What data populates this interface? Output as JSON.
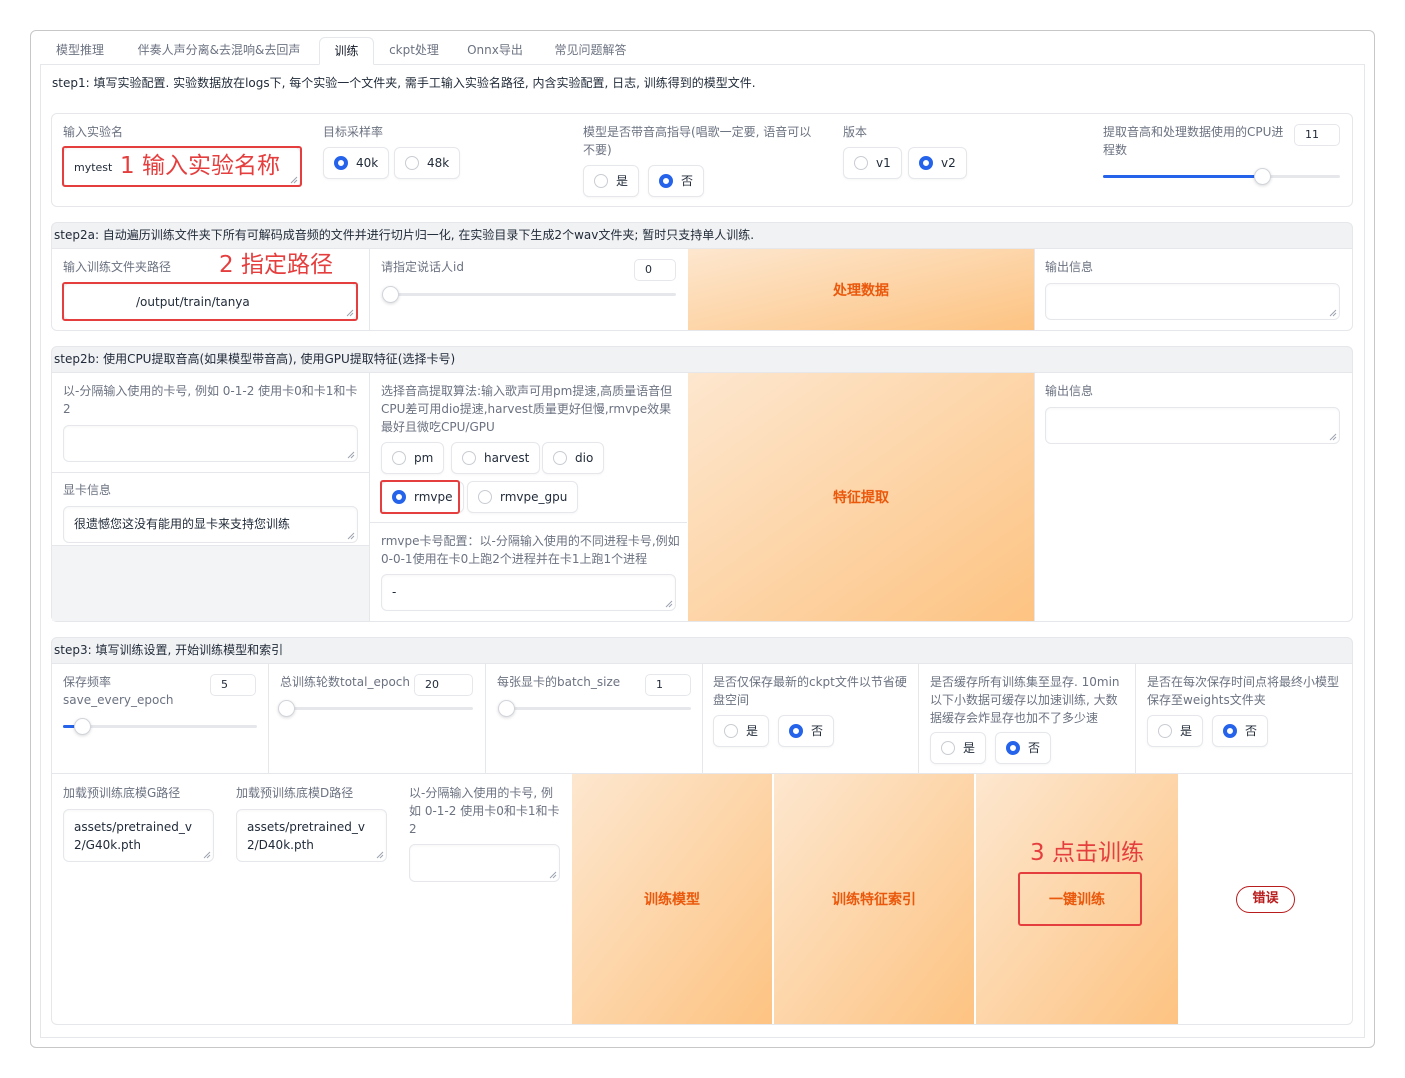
{
  "tabs": [
    "模型推理",
    "伴奏人声分离&去混响&去回声",
    "训练",
    "ckpt处理",
    "Onnx导出",
    "常见问题解答"
  ],
  "step1": {
    "desc": "step1: 填写实验配置. 实验数据放在logs下, 每个实验一个文件夹, 需手工输入实验名路径, 内含实验配置, 日志, 训练得到的模型文件.",
    "exp_name_label": "输入实验名",
    "exp_name_value": "mytest",
    "annotation": "1 输入实验名称",
    "sr_label": "目标采样率",
    "sr_options": [
      "40k",
      "48k"
    ],
    "pitch_label": "模型是否带音高指导(唱歌一定要, 语音可以不要)",
    "pitch_options": [
      "是",
      "否"
    ],
    "version_label": "版本",
    "version_options": [
      "v1",
      "v2"
    ],
    "cpu_label": "提取音高和处理数据使用的CPU进程数",
    "cpu_value": "11",
    "cpu_fraction": 0.67
  },
  "step2a": {
    "desc": "step2a: 自动遍历训练文件夹下所有可解码成音频的文件并进行切片归一化, 在实验目录下生成2个wav文件夹; 暂时只支持单人训练.",
    "folder_label": "输入训练文件夹路径",
    "folder_value": "/output/train/tanya",
    "annotation": "2 指定路径",
    "speaker_label": "请指定说话人id",
    "speaker_value": "0",
    "process_button": "处理数据",
    "output_label": "输出信息"
  },
  "step2b": {
    "desc": "step2b: 使用CPU提取音高(如果模型带音高), 使用GPU提取特征(选择卡号)",
    "gpus_label": "以-分隔输入使用的卡号, 例如 0-1-2 使用卡0和卡1和卡2",
    "gpu_info_label": "显卡信息",
    "gpu_info_value": "很遗憾您这没有能用的显卡来支持您训练",
    "f0_label": "选择音高提取算法:输入歌声可用pm提速,高质量语音但CPU差可用dio提速,harvest质量更好但慢,rmvpe效果最好且微吃CPU/GPU",
    "f0_options": [
      "pm",
      "harvest",
      "dio",
      "rmvpe",
      "rmvpe_gpu"
    ],
    "rmvpe_label": "rmvpe卡号配置：以-分隔输入使用的不同进程卡号,例如0-0-1使用在卡0上跑2个进程并在卡1上跑1个进程",
    "rmvpe_value": "-",
    "extract_button": "特征提取",
    "output_label": "输出信息"
  },
  "step3": {
    "desc": "step3: 填写训练设置, 开始训练模型和索引",
    "save_label": "保存频率save_every_epoch",
    "save_value": "5",
    "save_fraction": 0.1,
    "epoch_label": "总训练轮数total_epoch",
    "epoch_value": "20",
    "epoch_fraction": 0.02,
    "batch_label": "每张显卡的batch_size",
    "batch_value": "1",
    "batch_fraction": 0.0,
    "latest_label": "是否仅保存最新的ckpt文件以节省硬盘空间",
    "latest_options": [
      "是",
      "否"
    ],
    "cache_label": "是否缓存所有训练集至显存. 10min以下小数据可缓存以加速训练, 大数据缓存会炸显存也加不了多少速",
    "cache_options": [
      "是",
      "否"
    ],
    "weights_label": "是否在每次保存时间点将最终小模型保存至weights文件夹",
    "weights_options": [
      "是",
      "否"
    ],
    "pretrained_g_label": "加载预训练底模G路径",
    "pretrained_g_value": "assets/pretrained_v2/G40k.pth",
    "pretrained_d_label": "加载预训练底模D路径",
    "pretrained_d_value": "assets/pretrained_v2/D40k.pth",
    "gpus_label": "以-分隔输入使用的卡号, 例如 0-1-2 使用卡0和卡1和卡2",
    "train_button": "训练模型",
    "index_button": "训练特征索引",
    "onekey_button": "一键训练",
    "annotation": "3 点击训练",
    "error_badge": "错误"
  },
  "colors": {
    "accent": "#2563eb",
    "orange_text": "#ea580c",
    "annotation_red": "#e53e3e",
    "error_red": "#b91c1c"
  }
}
